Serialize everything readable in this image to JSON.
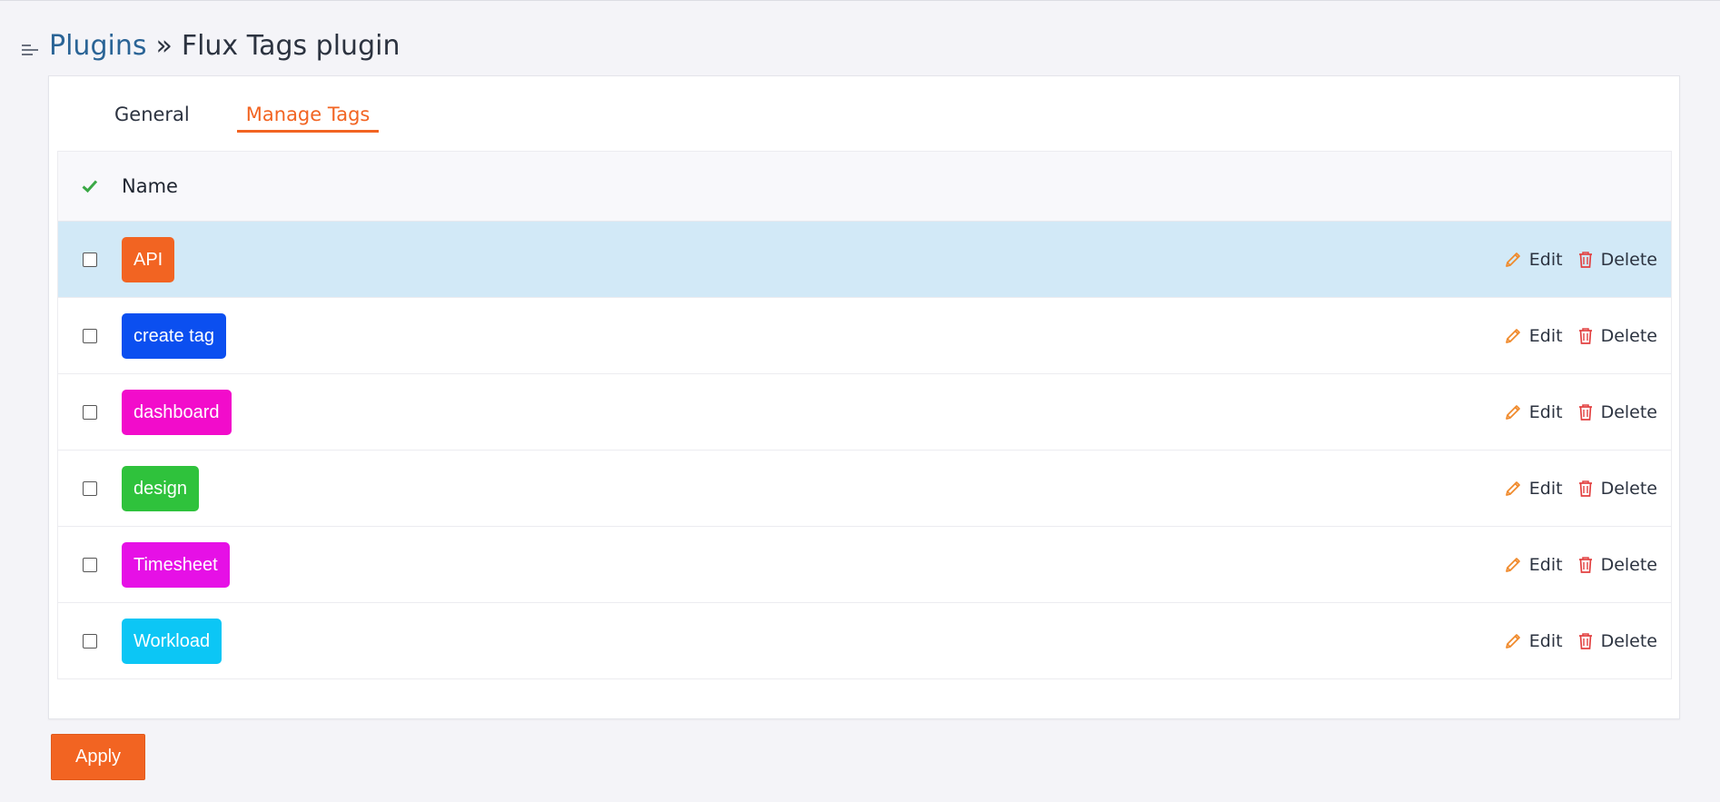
{
  "breadcrumb": {
    "parent": "Plugins",
    "separator": "»",
    "current": "Flux Tags plugin"
  },
  "tabs": [
    {
      "label": "General",
      "active": false
    },
    {
      "label": "Manage Tags",
      "active": true
    }
  ],
  "table": {
    "header_name": "Name",
    "edit_label": "Edit",
    "delete_label": "Delete",
    "rows": [
      {
        "name": "API",
        "color": "#f26422",
        "highlighted": true
      },
      {
        "name": "create tag",
        "color": "#0b4ff0",
        "highlighted": false
      },
      {
        "name": "dashboard",
        "color": "#f20ccb",
        "highlighted": false
      },
      {
        "name": "design",
        "color": "#2fc23c",
        "highlighted": false
      },
      {
        "name": "Timesheet",
        "color": "#e610e6",
        "highlighted": false
      },
      {
        "name": "Workload",
        "color": "#0cc6f5",
        "highlighted": false
      }
    ]
  },
  "apply_label": "Apply",
  "colors": {
    "accent": "#f26422",
    "link": "#2a6496",
    "highlight": "#d2e9f7"
  },
  "icons": {
    "menu": "menu-icon",
    "check": "check-icon",
    "edit": "pencil-icon",
    "delete": "trash-icon"
  }
}
